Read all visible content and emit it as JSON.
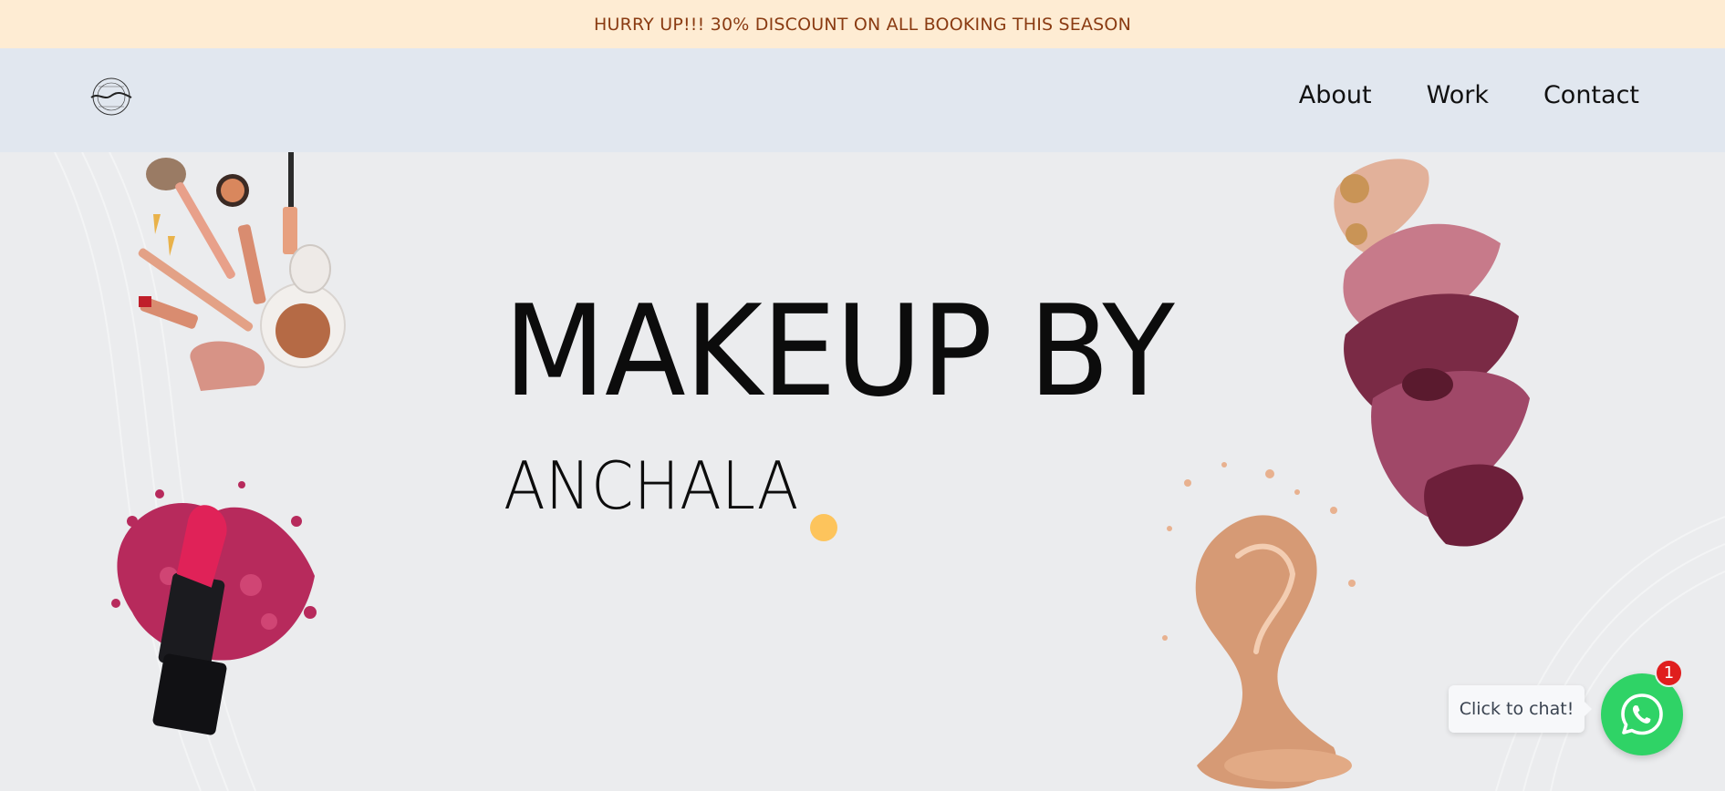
{
  "promo": {
    "text": "HURRY UP!!! 30% DISCOUNT ON ALL BOOKING THIS SEASON"
  },
  "header": {
    "logo_alt": "makeupanchala",
    "nav": [
      {
        "label": "About"
      },
      {
        "label": "Work"
      },
      {
        "label": "Contact"
      }
    ]
  },
  "hero": {
    "title": "MAKEUP BY",
    "subtitle": "ANCHALA"
  },
  "chat": {
    "label": "Click to chat!",
    "badge_count": "1"
  },
  "colors": {
    "promo_bg": "#feecd3",
    "promo_text": "#8a3b12",
    "nav_bg": "#e1e7ef",
    "hero_bg": "#ebecee",
    "accent_dot": "#fdc45c",
    "whatsapp": "#2fd366",
    "badge": "#e01e1e"
  },
  "icons": {
    "whatsapp": "whatsapp-icon",
    "logo": "logo-icon"
  }
}
